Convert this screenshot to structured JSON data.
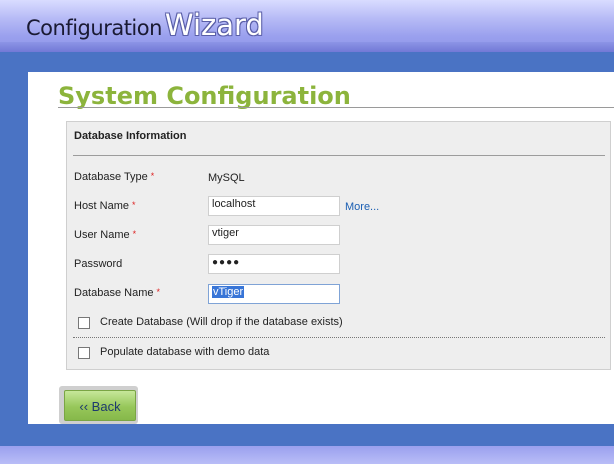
{
  "header": {
    "brand_word1": "Configuration",
    "brand_word2": "Wizard"
  },
  "page": {
    "title": "System Configuration"
  },
  "section": {
    "heading": "Database Information"
  },
  "fields": {
    "db_type_label": "Database Type",
    "db_type_value": "MySQL",
    "host_label": "Host Name",
    "host_value": "localhost",
    "more_link": "More...",
    "user_label": "User Name",
    "user_value": "vtiger",
    "password_label": "Password",
    "password_value": "●●●●",
    "dbname_label": "Database Name",
    "dbname_value": "vTiger",
    "required_mark": "*"
  },
  "checkboxes": {
    "create_db": {
      "label": "Create Database (Will drop if the database exists)",
      "checked": false
    },
    "demo_data": {
      "label": "Populate database with demo data",
      "checked": false
    }
  },
  "buttons": {
    "back": "‹‹ Back"
  },
  "colors": {
    "title_green": "#8cb43c",
    "page_blue": "#4a73c4",
    "header_lavender": "#9aa0ee",
    "link_blue": "#1b5fb3",
    "required_red": "#d22222"
  }
}
